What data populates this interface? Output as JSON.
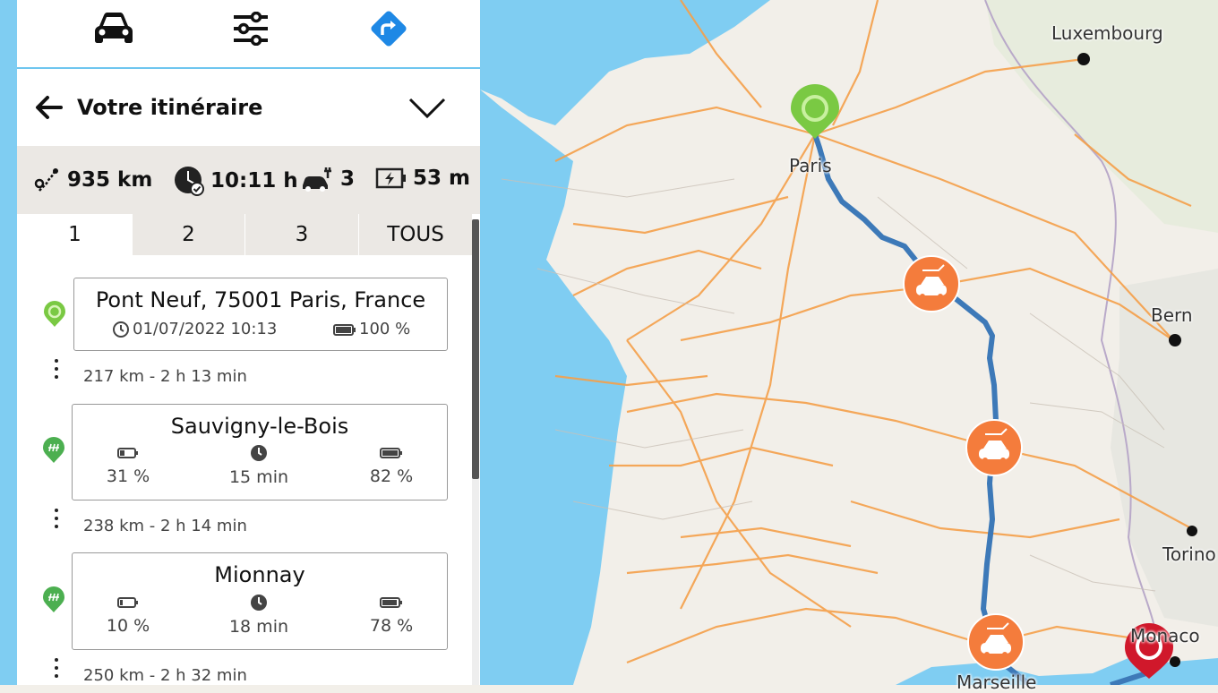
{
  "toolbar": {
    "icons": [
      "car-icon",
      "sliders-icon",
      "route-icon"
    ],
    "route_color": "#1e88e5"
  },
  "header": {
    "title": "Votre itinéraire"
  },
  "summary": {
    "distance": "935 km",
    "duration": "10:11 h",
    "charges": "3",
    "charge_time": "53 m"
  },
  "tabs": [
    "1",
    "2",
    "3",
    "TOUS"
  ],
  "itinerary": {
    "start": {
      "address": "Pont Neuf, 75001 Paris, France",
      "datetime": "01/07/2022 10:13",
      "battery": "100 %"
    },
    "legs": [
      "217 km -  2 h 13 min",
      "238 km -  2 h 14 min",
      "250 km -  2 h 32 min"
    ],
    "stops": [
      {
        "name": "Sauvigny-le-Bois",
        "arrive": "31 %",
        "charge": "15 min",
        "depart": "82 %"
      },
      {
        "name": "Mionnay",
        "arrive": "10 %",
        "charge": "18 min",
        "depart": "78 %"
      }
    ]
  },
  "map": {
    "labels": [
      "Luxembourg",
      "Bern",
      "Paris",
      "Torino",
      "Monaco",
      "Marseille"
    ],
    "colors": {
      "sea": "#7fcdf2",
      "land": "#f2efe9",
      "route": "#3d79b8",
      "start": "#7ac943",
      "end": "#d0182b",
      "charger": "#f47c3c",
      "roads": "#f5a04a"
    }
  }
}
